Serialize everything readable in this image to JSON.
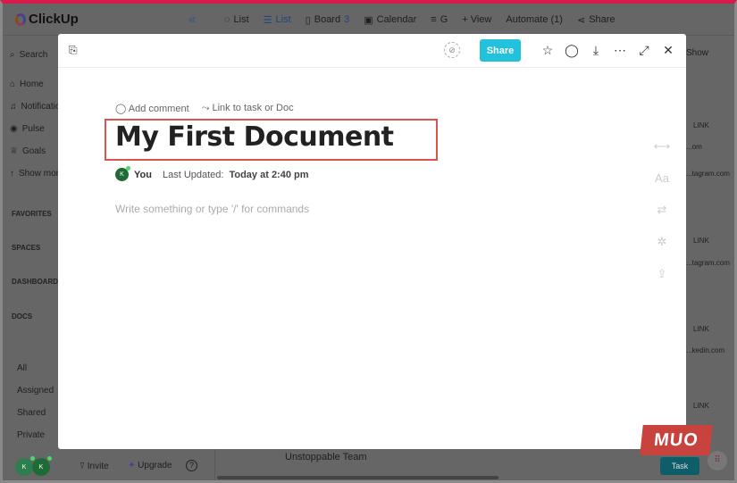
{
  "app": {
    "brand": "ClickUp"
  },
  "topbar": {
    "tabs": [
      {
        "label": "List"
      },
      {
        "label": "List",
        "active": true
      },
      {
        "label": "Board",
        "count": "3"
      },
      {
        "label": "Calendar"
      },
      {
        "label": "G"
      }
    ],
    "add_view": "+ View",
    "automate": "Automate (1)",
    "share": "Share"
  },
  "sidebar": {
    "search": "Search",
    "items": [
      {
        "label": "Home",
        "icon": "home-icon"
      },
      {
        "label": "Notifications",
        "icon": "bell-icon"
      },
      {
        "label": "Pulse",
        "icon": "pulse-icon"
      },
      {
        "label": "Goals",
        "icon": "trophy-icon"
      },
      {
        "label": "Show more",
        "icon": "arrow-up-icon"
      }
    ],
    "sections": [
      "FAVORITES",
      "SPACES",
      "DASHBOARDS",
      "DOCS"
    ],
    "doc_filters": [
      "All",
      "Assigned",
      "Shared",
      "Private"
    ]
  },
  "right_col": {
    "show": "Show",
    "links": [
      {
        "header": "LINK",
        "value": "...om"
      },
      {
        "value": "...tagram.com"
      },
      {
        "header": "LINK",
        "value": "...tagram.com"
      },
      {
        "header": "LINK",
        "value": "...kedin.com"
      },
      {
        "header": "LINK"
      }
    ]
  },
  "footer": {
    "avatar1": "K",
    "avatar2": "K",
    "invite": "Invite",
    "upgrade": "Upgrade",
    "team": "Unstoppable Team",
    "task_button": "Task"
  },
  "modal": {
    "share_label": "Share",
    "add_comment": "Add comment",
    "link_task": "Link to task or Doc",
    "title": "My First Document",
    "author_initial": "K",
    "author": "You",
    "last_updated_label": "Last Updated:",
    "last_updated_value": "Today at 2:40 pm",
    "placeholder": "Write something or type '/' for commands"
  },
  "watermark": "MUO",
  "colors": {
    "share": "#22c1dc",
    "highlight": "#d9534f",
    "accent_bar": "#d81b4c"
  }
}
